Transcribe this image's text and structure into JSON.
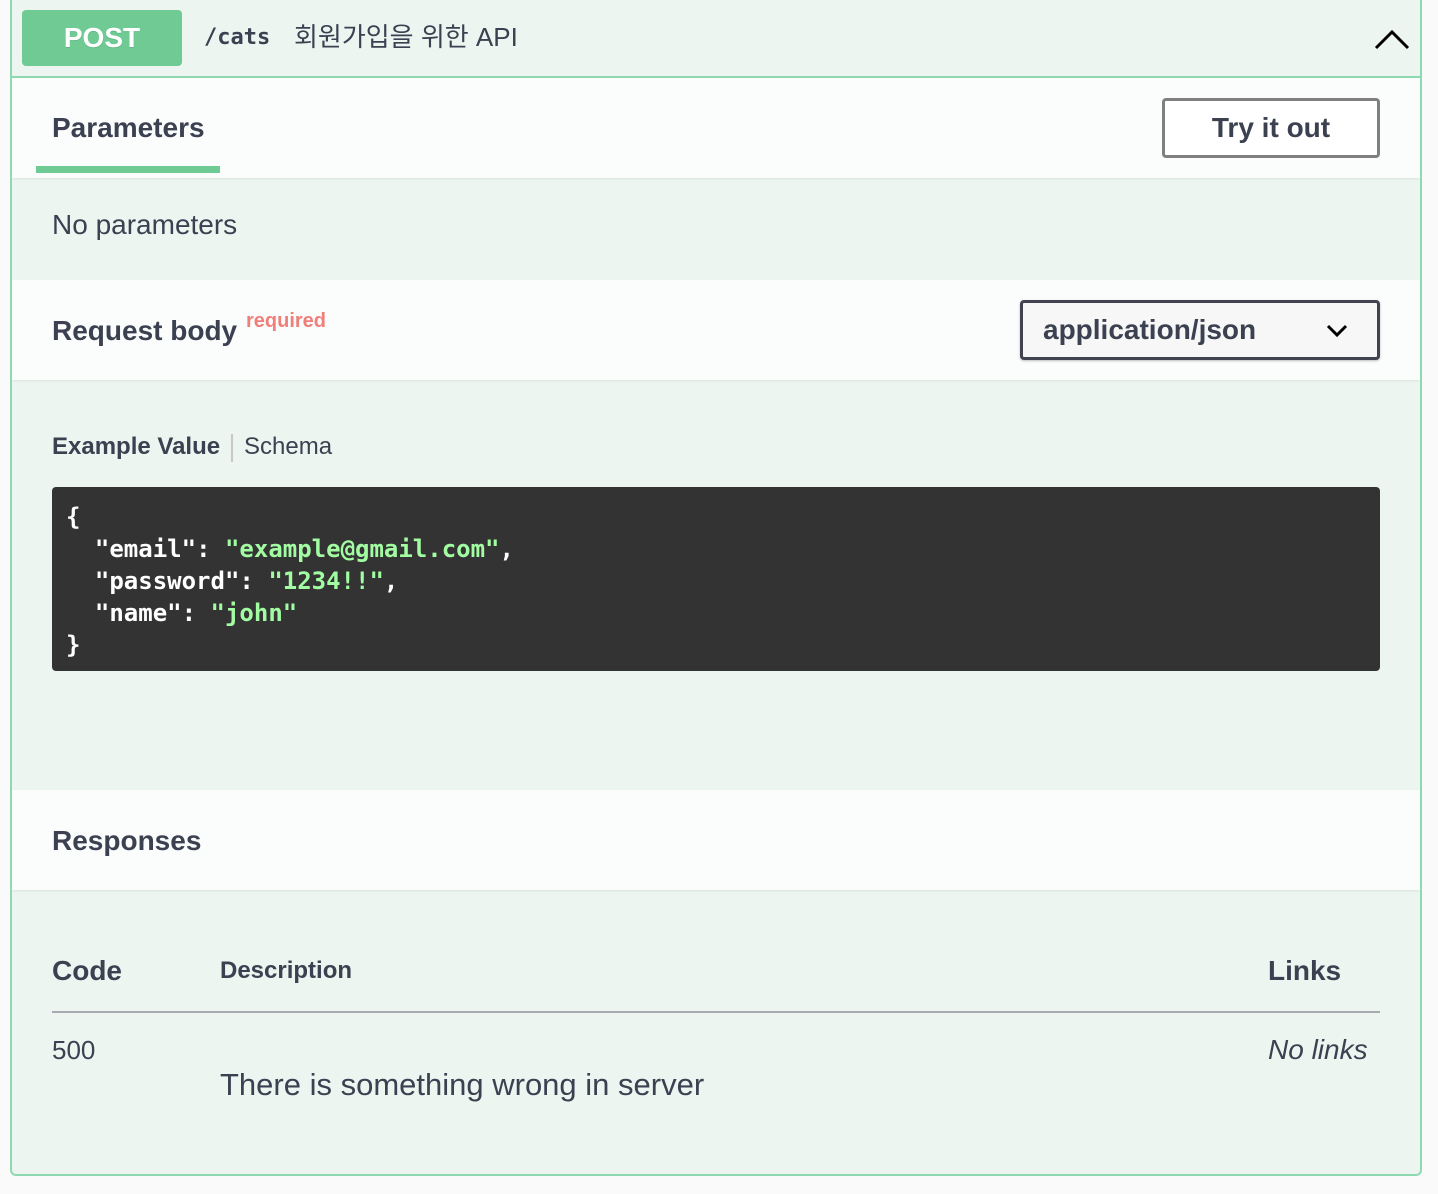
{
  "summary": {
    "method": "POST",
    "path": "/cats",
    "description": "회원가입을 위한 API",
    "collapse_icon": "chevron-up-icon"
  },
  "parameters": {
    "tab_label": "Parameters",
    "try_button": "Try it out",
    "empty_text": "No parameters"
  },
  "request_body": {
    "title": "Request body",
    "required_label": "required",
    "content_type": "application/json",
    "dropdown_icon": "chevron-down-icon",
    "tabs": {
      "example": "Example Value",
      "schema": "Schema"
    },
    "example": {
      "open": "{",
      "lines": [
        {
          "key": "\"email\"",
          "value": "\"example@gmail.com\"",
          "trail": ","
        },
        {
          "key": "\"password\"",
          "value": "\"1234!!\"",
          "trail": ","
        },
        {
          "key": "\"name\"",
          "value": "\"john\"",
          "trail": ""
        }
      ],
      "close": "}"
    }
  },
  "responses": {
    "title": "Responses",
    "columns": {
      "code": "Code",
      "description": "Description",
      "links": "Links"
    },
    "rows": [
      {
        "code": "500",
        "description": "There is something wrong in server",
        "links": "No links"
      }
    ]
  },
  "colors": {
    "method_bg": "#6fcb93",
    "border": "#8fd9b0",
    "panel_bg": "#edf5f0",
    "code_bg": "#333333",
    "string_color": "#a2fca2",
    "required_color": "#f07f7a"
  }
}
